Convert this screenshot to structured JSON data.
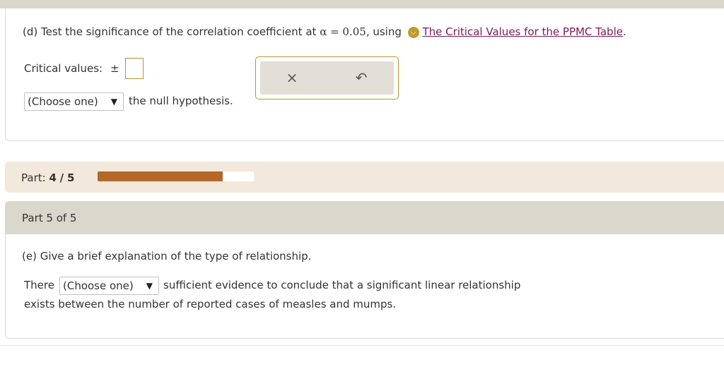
{
  "part_d": {
    "prefix": "(d) Test the significance of the correlation coefficient at",
    "alpha_expr": "α = 0.05",
    "using": ", using",
    "help_icon": "chevron-down-icon",
    "link_text": "The Critical Values for the PPMC Table",
    "period": ".",
    "critical_label": "Critical values:",
    "plus_minus": "±",
    "critical_value": "",
    "select_value": "(Choose one)",
    "select_caret": "▼",
    "select_after": "the null hypothesis."
  },
  "actions": {
    "clear_symbol": "×",
    "undo_symbol": "↶"
  },
  "progress": {
    "label": "Part:",
    "current": "4",
    "separator": "/",
    "total": "5",
    "fraction": 0.8,
    "fill_color": "#b5672a"
  },
  "part_e": {
    "header": "Part 5 of 5",
    "question": "(e) Give a brief explanation of the type of relationship.",
    "there": "There",
    "select_value": "(Choose one)",
    "select_caret": "▼",
    "after_select": "sufficient evidence to conclude that a significant linear relationship",
    "line2": "exists between the number of reported cases of measles and mumps."
  }
}
